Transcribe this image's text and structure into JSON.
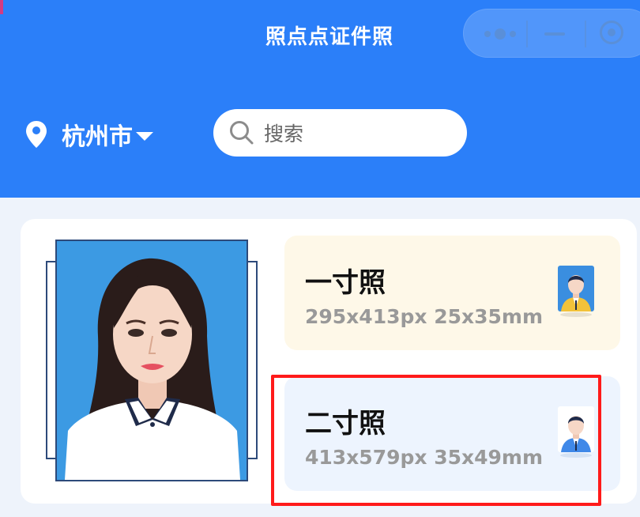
{
  "nav": {
    "title": "照点点证件照"
  },
  "location": {
    "city": "杭州市"
  },
  "search": {
    "placeholder": "搜索"
  },
  "options": [
    {
      "title": "一寸照",
      "spec": "295x413px 25x35mm"
    },
    {
      "title": "二寸照",
      "spec": "413x579px 35x49mm"
    }
  ],
  "colors": {
    "brand_blue": "#2b7ff9",
    "highlight_red": "#ff1a1a",
    "spec_gray": "#999999"
  }
}
